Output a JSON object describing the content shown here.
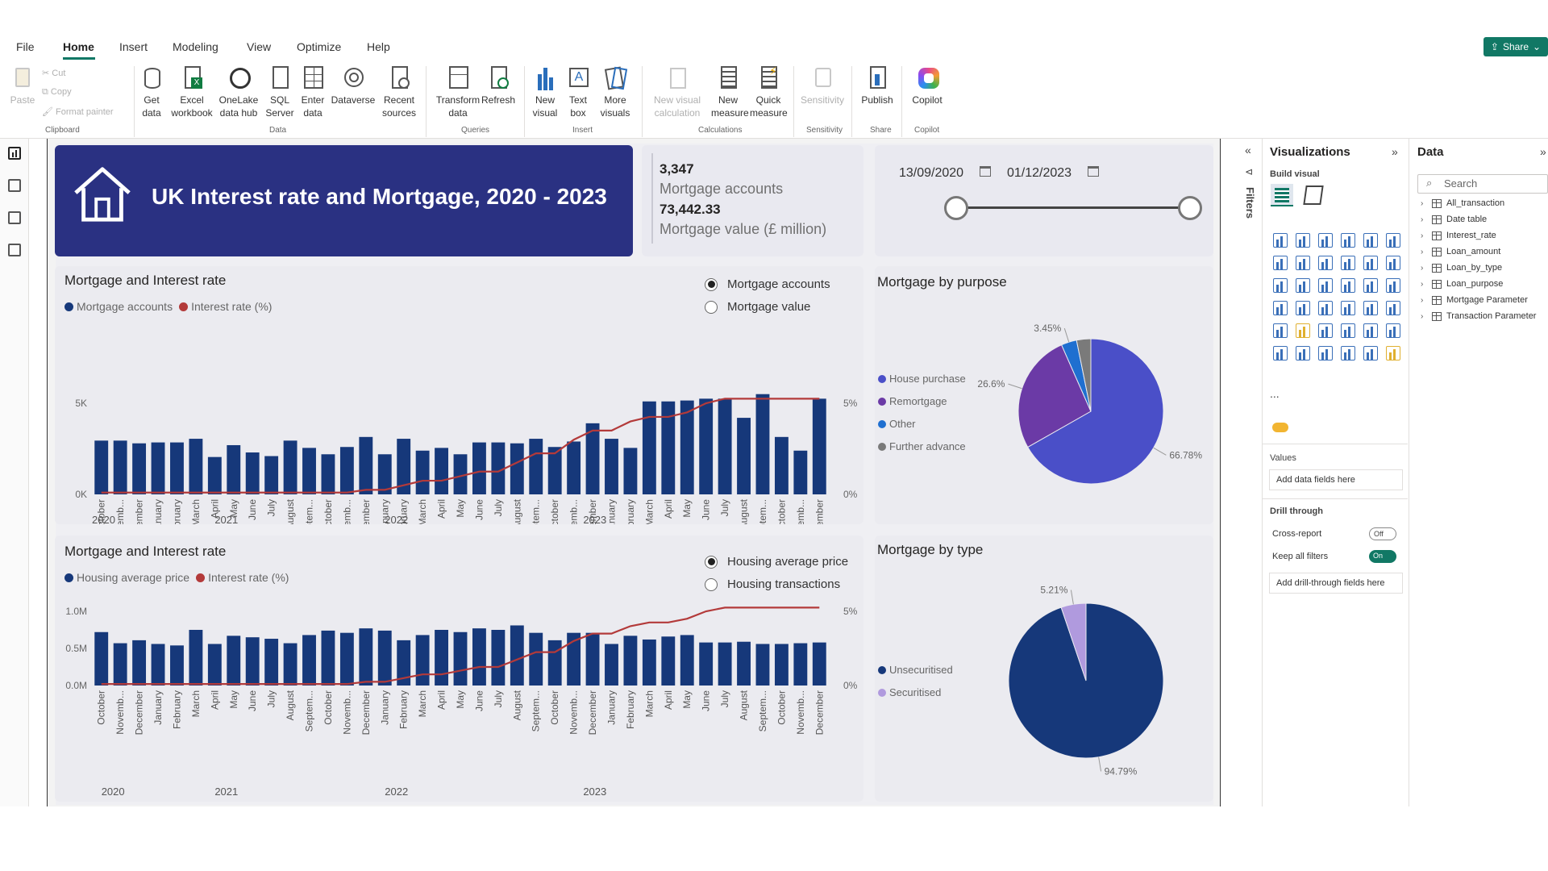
{
  "menu": [
    "File",
    "Home",
    "Insert",
    "Modeling",
    "View",
    "Optimize",
    "Help"
  ],
  "share_label": "Share",
  "ribbon": {
    "clipboard": {
      "paste": "Paste",
      "cut": "Cut",
      "copy": "Copy",
      "format_painter": "Format painter",
      "label": "Clipboard"
    },
    "data": {
      "buttons": [
        "Get data",
        "Excel workbook",
        "OneLake data hub",
        "SQL Server",
        "Enter data",
        "Dataverse",
        "Recent sources"
      ],
      "label": "Data"
    },
    "queries": {
      "buttons": [
        "Transform data",
        "Refresh"
      ],
      "label": "Queries"
    },
    "insert": {
      "buttons": [
        "New visual",
        "Text box",
        "More visuals"
      ],
      "label": "Insert"
    },
    "calculations": {
      "buttons": [
        "New visual calculation",
        "New measure",
        "Quick measure"
      ],
      "label": "Calculations"
    },
    "sensitivity": {
      "buttons": [
        "Sensitivity"
      ],
      "label": "Sensitivity"
    },
    "share": {
      "buttons": [
        "Publish"
      ],
      "label": "Share"
    },
    "copilot": {
      "buttons": [
        "Copilot"
      ],
      "label": "Copilot"
    }
  },
  "header": {
    "title": "UK Interest rate and Mortgage, 2020 - 2023"
  },
  "kpi": {
    "accounts_value": "3,347",
    "accounts_label": "Mortgage accounts",
    "mortgage_value": "73,442.33",
    "mortgage_value_label": "Mortgage value (£ million)"
  },
  "slicer": {
    "start_date": "13/09/2020",
    "end_date": "01/12/2023"
  },
  "panel1": {
    "title": "Mortgage and Interest rate",
    "legend": [
      "Mortgage accounts",
      "Interest rate (%)"
    ],
    "radio": [
      {
        "label": "Mortgage accounts",
        "selected": true
      },
      {
        "label": "Mortgage value",
        "selected": false
      }
    ]
  },
  "panel2": {
    "title": "Mortgage and Interest rate",
    "legend": [
      "Housing average price",
      "Interest rate (%)"
    ],
    "radio": [
      {
        "label": "Housing average price",
        "selected": true
      },
      {
        "label": "Housing transactions",
        "selected": false
      }
    ]
  },
  "pie1": {
    "title": "Mortgage by purpose"
  },
  "pie2": {
    "title": "Mortgage by type"
  },
  "colors": {
    "bar": "#16387a",
    "line": "#b33a3a",
    "header": "#2a3182",
    "accent": "#117865"
  },
  "chart_data": [
    {
      "type": "bar",
      "title": "Mortgage and Interest rate",
      "categories": [
        "October",
        "Novemb...",
        "December",
        "January",
        "February",
        "March",
        "April",
        "May",
        "June",
        "July",
        "August",
        "Septem...",
        "October",
        "Novemb...",
        "December",
        "January",
        "February",
        "March",
        "April",
        "May",
        "June",
        "July",
        "August",
        "Septem...",
        "October",
        "Novemb...",
        "December",
        "January",
        "February",
        "March",
        "April",
        "May",
        "June",
        "July",
        "August",
        "Septem...",
        "October",
        "Novemb...",
        "December"
      ],
      "year_labels": [
        "2020",
        "2021",
        "2022",
        "2023"
      ],
      "y_ticks": [
        "5K",
        "0K"
      ],
      "y2_ticks": [
        "5%",
        "0%"
      ],
      "ylim": [
        0,
        5000
      ],
      "y2lim": [
        0,
        5
      ],
      "series": [
        {
          "name": "Mortgage accounts",
          "type": "bar",
          "values": [
            2950,
            2950,
            2800,
            2850,
            2850,
            3050,
            2050,
            2700,
            2300,
            2100,
            2950,
            2550,
            2200,
            2600,
            3150,
            2200,
            3050,
            2400,
            2550,
            2200,
            2850,
            2850,
            2800,
            3050,
            2600,
            2900,
            3900,
            3050,
            2550,
            5100,
            5100,
            5150,
            5250,
            5250,
            4200,
            5500,
            3150,
            2400,
            5250
          ]
        },
        {
          "name": "Interest rate (%)",
          "type": "line",
          "axis": "right",
          "values": [
            0.1,
            0.1,
            0.1,
            0.1,
            0.1,
            0.1,
            0.1,
            0.1,
            0.1,
            0.1,
            0.1,
            0.1,
            0.1,
            0.1,
            0.25,
            0.25,
            0.5,
            0.75,
            0.75,
            1.0,
            1.25,
            1.25,
            1.75,
            2.25,
            2.25,
            3.0,
            3.5,
            3.5,
            4.0,
            4.25,
            4.25,
            4.5,
            5.0,
            5.25,
            5.25,
            5.25,
            5.25,
            5.25,
            5.25
          ]
        }
      ]
    },
    {
      "type": "bar",
      "title": "Mortgage and Interest rate",
      "categories": [
        "October",
        "Novemb...",
        "December",
        "January",
        "February",
        "March",
        "April",
        "May",
        "June",
        "July",
        "August",
        "Septem...",
        "October",
        "Novemb...",
        "December",
        "January",
        "February",
        "March",
        "April",
        "May",
        "June",
        "July",
        "August",
        "Septem...",
        "October",
        "Novemb...",
        "December",
        "January",
        "February",
        "March",
        "April",
        "May",
        "June",
        "July",
        "August",
        "Septem...",
        "October",
        "Novemb...",
        "December"
      ],
      "year_labels": [
        "2020",
        "2021",
        "2022",
        "2023"
      ],
      "y_ticks": [
        "1.0M",
        "0.5M",
        "0.0M"
      ],
      "y2_ticks": [
        "5%",
        "0%"
      ],
      "ylim": [
        0,
        1000000
      ],
      "y2lim": [
        0,
        5
      ],
      "series": [
        {
          "name": "Housing average price",
          "type": "bar",
          "values": [
            720000,
            570000,
            610000,
            560000,
            540000,
            750000,
            560000,
            670000,
            650000,
            630000,
            570000,
            680000,
            740000,
            710000,
            770000,
            740000,
            610000,
            680000,
            750000,
            720000,
            770000,
            750000,
            810000,
            710000,
            610000,
            710000,
            710000,
            560000,
            670000,
            620000,
            660000,
            680000,
            580000,
            580000,
            590000,
            560000,
            560000,
            570000,
            580000
          ]
        },
        {
          "name": "Interest rate (%)",
          "type": "line",
          "axis": "right",
          "values": [
            0.1,
            0.1,
            0.1,
            0.1,
            0.1,
            0.1,
            0.1,
            0.1,
            0.1,
            0.1,
            0.1,
            0.1,
            0.1,
            0.1,
            0.25,
            0.25,
            0.5,
            0.75,
            0.75,
            1.0,
            1.25,
            1.25,
            1.75,
            2.25,
            2.25,
            3.0,
            3.5,
            3.5,
            4.0,
            4.25,
            4.25,
            4.5,
            5.0,
            5.25,
            5.25,
            5.25,
            5.25,
            5.25,
            5.25
          ]
        }
      ]
    },
    {
      "type": "pie",
      "title": "Mortgage by purpose",
      "categories": [
        "House purchase",
        "Remortgage",
        "Other",
        "Further advance"
      ],
      "values": [
        66.78,
        26.6,
        3.45,
        3.17
      ],
      "data_labels": [
        "66.78%",
        "26.6%",
        "3.45%"
      ],
      "colors": [
        "#4a4fc8",
        "#6b3aa6",
        "#1f6fd0",
        "#7a7a7a"
      ],
      "legend": "left"
    },
    {
      "type": "pie",
      "title": "Mortgage by type",
      "categories": [
        "Unsecuritised",
        "Securitised"
      ],
      "values": [
        94.79,
        5.21
      ],
      "data_labels": [
        "94.79%",
        "5.21%"
      ],
      "colors": [
        "#16387a",
        "#b09ade"
      ],
      "legend": "left"
    }
  ],
  "filters_label": "Filters",
  "visualizations": {
    "title": "Visualizations",
    "build_visual": "Build visual",
    "values_label": "Values",
    "add_fields": "Add data fields here",
    "drill_through": "Drill through",
    "cross_report": "Cross-report",
    "cross_report_state": "Off",
    "keep_filters": "Keep all filters",
    "keep_filters_state": "On",
    "add_drill": "Add drill-through fields here",
    "more": "..."
  },
  "data_pane": {
    "title": "Data",
    "search_placeholder": "Search",
    "tables": [
      "All_transaction",
      "Date table",
      "Interest_rate",
      "Loan_amount",
      "Loan_by_type",
      "Loan_purpose",
      "Mortgage Parameter",
      "Transaction Parameter"
    ]
  }
}
